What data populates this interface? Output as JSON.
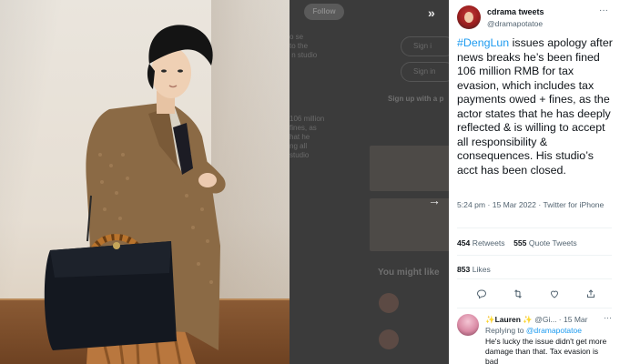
{
  "background_panel": {
    "follow_label": "Follow",
    "signup_heading": "Sign up with a p",
    "you_might_like": "You might like",
    "sign_in_google": "Sign i",
    "sign_in_apple": "Sign in",
    "snippet_1": "o se\nto the\n n studio",
    "snippet_2": "106 million\nfines, as\nhat he\nng all\nstudio"
  },
  "tweet": {
    "author_name": "cdrama tweets",
    "author_handle": "@dramapotatoe",
    "hashtag": "#DengLun",
    "body": " issues apology after news breaks he’s been fined 106 million RMB for tax evasion, which includes tax payments owed + fines, as the actor states that he has deeply reflected & is willing to accept all responsibility & consequences. His studio’s acct has been closed.",
    "timestamp": "5:24 pm · 15 Mar 2022 · ",
    "client": "Twitter for iPhone",
    "retweets_count": "454",
    "retweets_label": " Retweets",
    "quotes_count": "555",
    "quotes_label": " Quote Tweets",
    "likes_count": "853",
    "likes_label": " Likes",
    "more_glyph": "···"
  },
  "reply": {
    "name": "✨Lauren ✨",
    "handle_date": " @Gi... · 15 Mar",
    "replying_prefix": "Replying to ",
    "replying_handle": "@dramapotatoe",
    "text": "He's lucky the issue didn't get more damage than that. Tax evasion is bad",
    "more_glyph": "···"
  },
  "nav": {
    "collapse_glyph": "»",
    "next_glyph": "→"
  },
  "colors": {
    "accent": "#1d9bf0",
    "text_primary": "#0f1419",
    "text_secondary": "#536471"
  }
}
